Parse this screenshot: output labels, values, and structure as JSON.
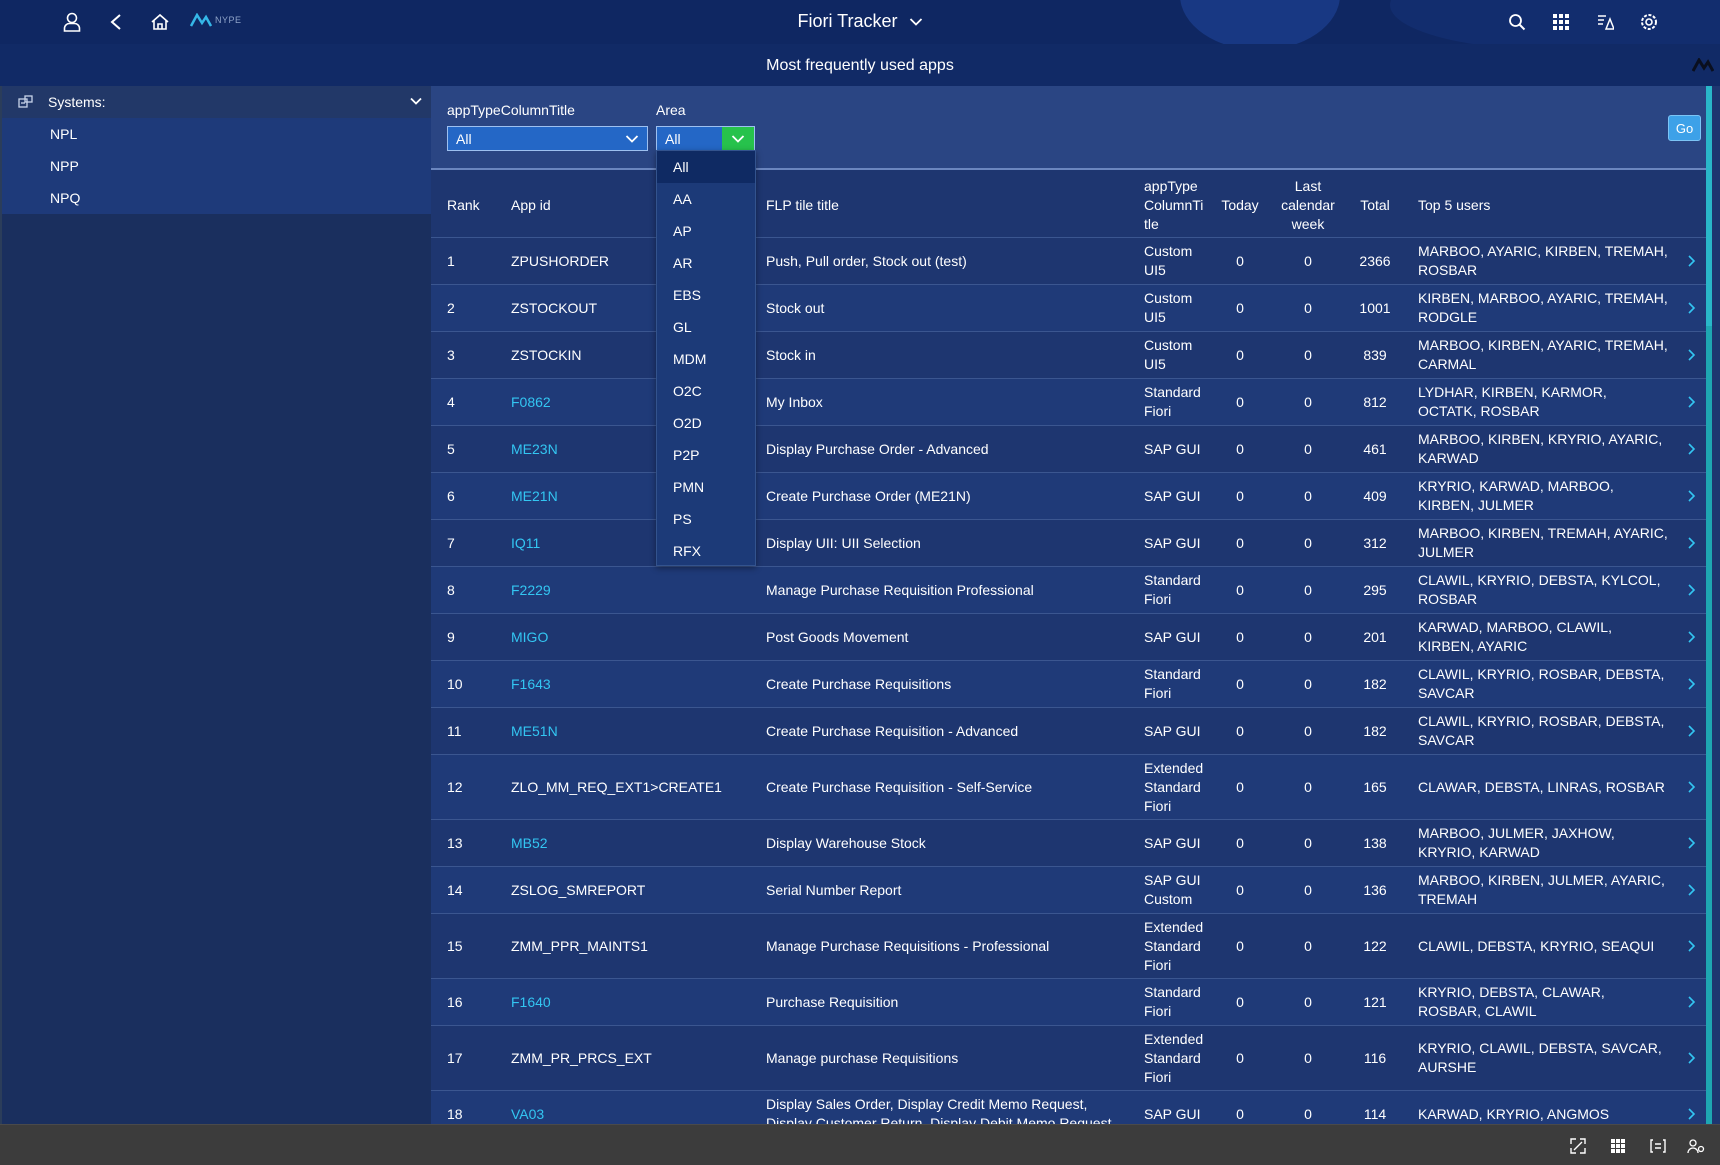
{
  "shell": {
    "title": "Fiori Tracker",
    "logo_text": "NYPE",
    "icons": [
      "user-icon",
      "back-icon",
      "home-icon",
      "search-icon",
      "app-finder-icon",
      "notifications-icon",
      "settings-icon"
    ]
  },
  "subheader": {
    "title": "Most frequently used apps"
  },
  "sidebar": {
    "header": "Systems:",
    "items": [
      {
        "label": "NPL"
      },
      {
        "label": "NPP"
      },
      {
        "label": "NPQ"
      }
    ]
  },
  "filters": {
    "apptype": {
      "label": "appTypeColumnTitle",
      "value": "All"
    },
    "area": {
      "label": "Area",
      "value": "All"
    },
    "go_label": "Go"
  },
  "area_dropdown": {
    "options": [
      "All",
      "AA",
      "AP",
      "AR",
      "EBS",
      "GL",
      "MDM",
      "O2C",
      "O2D",
      "P2P",
      "PMN",
      "PS",
      "RFX"
    ],
    "selected": "All"
  },
  "table": {
    "columns": {
      "rank": "Rank",
      "app_id": "App id",
      "flp_title": "FLP tile title",
      "app_type": "appType ColumnTi tle",
      "today": "Today",
      "last_week": "Last calendar week",
      "total": "Total",
      "top_users": "Top 5 users"
    },
    "rows": [
      {
        "rank": "1",
        "app_id": "ZPUSHORDER",
        "link": false,
        "title": "Push, Pull order, Stock out (test)",
        "type": "Custom UI5",
        "today": "0",
        "week": "0",
        "total": "2366",
        "users": "MARBOO, AYARIC, KIRBEN, TREMAH, ROSBAR"
      },
      {
        "rank": "2",
        "app_id": "ZSTOCKOUT",
        "link": false,
        "title": "Stock out",
        "type": "Custom UI5",
        "today": "0",
        "week": "0",
        "total": "1001",
        "users": "KIRBEN, MARBOO, AYARIC, TREMAH, RODGLE"
      },
      {
        "rank": "3",
        "app_id": "ZSTOCKIN",
        "link": false,
        "title": "Stock in",
        "type": "Custom UI5",
        "today": "0",
        "week": "0",
        "total": "839",
        "users": "MARBOO, KIRBEN, AYARIC, TREMAH, CARMAL"
      },
      {
        "rank": "4",
        "app_id": "F0862",
        "link": true,
        "title": "My Inbox",
        "type": "Standard Fiori",
        "today": "0",
        "week": "0",
        "total": "812",
        "users": "LYDHAR, KIRBEN, KARMOR, OCTATK, ROSBAR"
      },
      {
        "rank": "5",
        "app_id": "ME23N",
        "link": true,
        "title": "Display Purchase Order - Advanced",
        "type": "SAP GUI",
        "today": "0",
        "week": "0",
        "total": "461",
        "users": "MARBOO, KIRBEN, KRYRIO, AYARIC, KARWAD"
      },
      {
        "rank": "6",
        "app_id": "ME21N",
        "link": true,
        "title": "Create Purchase Order (ME21N)",
        "type": "SAP GUI",
        "today": "0",
        "week": "0",
        "total": "409",
        "users": "KRYRIO, KARWAD, MARBOO, KIRBEN, JULMER"
      },
      {
        "rank": "7",
        "app_id": "IQ11",
        "link": true,
        "title": "Display UII: UII Selection",
        "type": "SAP GUI",
        "today": "0",
        "week": "0",
        "total": "312",
        "users": "MARBOO, KIRBEN, TREMAH, AYARIC, JULMER"
      },
      {
        "rank": "8",
        "app_id": "F2229",
        "link": true,
        "title": "Manage Purchase Requisition Professional",
        "type": "Standard Fiori",
        "today": "0",
        "week": "0",
        "total": "295",
        "users": "CLAWIL, KRYRIO, DEBSTA, KYLCOL, ROSBAR"
      },
      {
        "rank": "9",
        "app_id": "MIGO",
        "link": true,
        "title": "Post Goods Movement",
        "type": "SAP GUI",
        "today": "0",
        "week": "0",
        "total": "201",
        "users": "KARWAD, MARBOO, CLAWIL, KIRBEN, AYARIC"
      },
      {
        "rank": "10",
        "app_id": "F1643",
        "link": true,
        "title": "Create Purchase Requisitions",
        "type": "Standard Fiori",
        "today": "0",
        "week": "0",
        "total": "182",
        "users": "CLAWIL, KRYRIO, ROSBAR, DEBSTA, SAVCAR"
      },
      {
        "rank": "11",
        "app_id": "ME51N",
        "link": true,
        "title": "Create Purchase Requisition - Advanced",
        "type": "SAP GUI",
        "today": "0",
        "week": "0",
        "total": "182",
        "users": "CLAWIL, KRYRIO, ROSBAR, DEBSTA, SAVCAR"
      },
      {
        "rank": "12",
        "app_id": "ZLO_MM_REQ_EXT1>CREATE1",
        "link": false,
        "title": "Create Purchase Requisition - Self-Service",
        "type": "Extended Standard Fiori",
        "today": "0",
        "week": "0",
        "total": "165",
        "users": "CLAWAR, DEBSTA, LINRAS, ROSBAR"
      },
      {
        "rank": "13",
        "app_id": "MB52",
        "link": true,
        "title": "Display Warehouse Stock",
        "type": "SAP GUI",
        "today": "0",
        "week": "0",
        "total": "138",
        "users": "MARBOO, JULMER, JAXHOW, KRYRIO, KARWAD"
      },
      {
        "rank": "14",
        "app_id": "ZSLOG_SMREPORT",
        "link": false,
        "title": "Serial Number Report",
        "type": "SAP GUI Custom",
        "today": "0",
        "week": "0",
        "total": "136",
        "users": "MARBOO, KIRBEN, JULMER, AYARIC, TREMAH"
      },
      {
        "rank": "15",
        "app_id": "ZMM_PPR_MAINTS1",
        "link": false,
        "title": "Manage Purchase Requisitions - Professional",
        "type": "Extended Standard Fiori",
        "today": "0",
        "week": "0",
        "total": "122",
        "users": "CLAWIL, DEBSTA, KRYRIO, SEAQUI"
      },
      {
        "rank": "16",
        "app_id": "F1640",
        "link": true,
        "title": "Purchase Requisition",
        "type": "Standard Fiori",
        "today": "0",
        "week": "0",
        "total": "121",
        "users": "KRYRIO, DEBSTA, CLAWAR, ROSBAR, CLAWIL"
      },
      {
        "rank": "17",
        "app_id": "ZMM_PR_PRCS_EXT",
        "link": false,
        "title": "Manage purchase Requisitions",
        "type": "Extended Standard Fiori",
        "today": "0",
        "week": "0",
        "total": "116",
        "users": "KRYRIO, CLAWIL, DEBSTA, SAVCAR, AURSHE"
      },
      {
        "rank": "18",
        "app_id": "VA03",
        "link": true,
        "title": "Display Sales Order, Display Credit Memo Request, Display Customer Return, Display Debit Memo Request",
        "type": "SAP GUI",
        "today": "0",
        "week": "0",
        "total": "114",
        "users": "KARWAD, KRYRIO, ANGMOS"
      }
    ]
  },
  "colors": {
    "link": "#33c6f2",
    "accent_green": "#27c24c",
    "go_button": "#3da1e8"
  }
}
